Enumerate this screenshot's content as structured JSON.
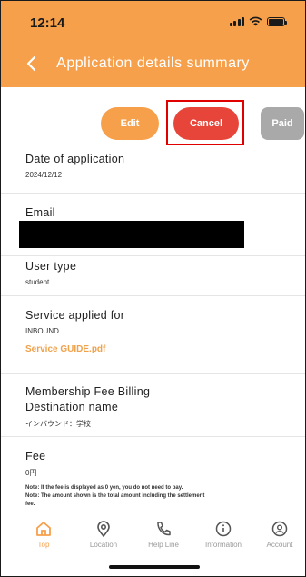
{
  "status": {
    "time": "12:14"
  },
  "header": {
    "title": "Application details summary"
  },
  "actions": {
    "edit": "Edit",
    "cancel": "Cancel",
    "paid": "Paid"
  },
  "fields": {
    "date_label": "Date of application",
    "date_value": "2024/12/12",
    "email_label": "Email",
    "user_type_label": "User type",
    "user_type_value": "student",
    "service_label": "Service applied for",
    "service_value": "INBOUND",
    "service_link": "Service GUIDE.pdf",
    "billing_label_1": "Membership Fee Billing",
    "billing_label_2": "Destination name",
    "billing_value": "インバウンド：学校",
    "fee_label": "Fee",
    "fee_value": "0円",
    "note_1": "Note: If the fee is displayed as 0 yen, you do not need to pay.",
    "note_2": "Note: The amount shown is the total amount including the settlement",
    "note_3": "fee."
  },
  "tabs": [
    {
      "label": "Top",
      "icon": "home-icon"
    },
    {
      "label": "Location",
      "icon": "location-pin-icon"
    },
    {
      "label": "Help Line",
      "icon": "phone-icon"
    },
    {
      "label": "Information",
      "icon": "info-icon"
    },
    {
      "label": "Account",
      "icon": "account-icon"
    }
  ],
  "colors": {
    "accent": "#f6a04c",
    "cancel": "#e8453a",
    "paid": "#a9a9a9",
    "highlight": "#e00000"
  }
}
